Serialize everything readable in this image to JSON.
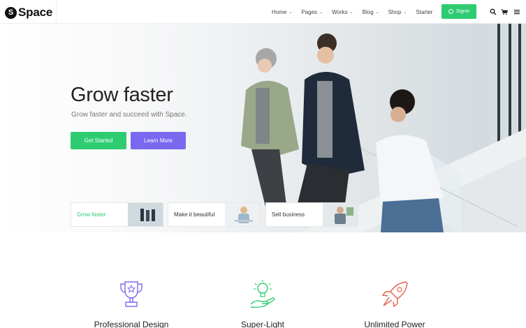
{
  "brand": {
    "initial": "S",
    "name": "Space"
  },
  "nav": {
    "items": [
      {
        "label": "Home",
        "dropdown": true
      },
      {
        "label": "Pages",
        "dropdown": true
      },
      {
        "label": "Works",
        "dropdown": true
      },
      {
        "label": "Blog",
        "dropdown": true
      },
      {
        "label": "Shop",
        "dropdown": true
      },
      {
        "label": "Starter",
        "dropdown": false
      }
    ],
    "caret": "⌄",
    "signin_label": "Signin",
    "icons": [
      "search-icon",
      "cart-icon",
      "menu-icon"
    ]
  },
  "hero": {
    "title": "Grow faster",
    "subtitle": "Grow faster and succeed with Space.",
    "primary_button": "Get Started",
    "secondary_button": "Learn More",
    "cards": [
      {
        "label": "Grow faster",
        "active": true
      },
      {
        "label": "Make it beautiful",
        "active": false
      },
      {
        "label": "Sell business",
        "active": false
      }
    ]
  },
  "features": [
    {
      "title": "Professional Design",
      "icon": "trophy-icon",
      "color": "#7a68f0"
    },
    {
      "title": "Super-Light",
      "icon": "lightbulb-hand-icon",
      "color": "#2ecc71"
    },
    {
      "title": "Unlimited Power",
      "icon": "rocket-icon",
      "color": "#e8604c"
    }
  ],
  "colors": {
    "accent_green": "#2ecc71",
    "accent_purple": "#7a68f0",
    "accent_red": "#e8604c"
  }
}
